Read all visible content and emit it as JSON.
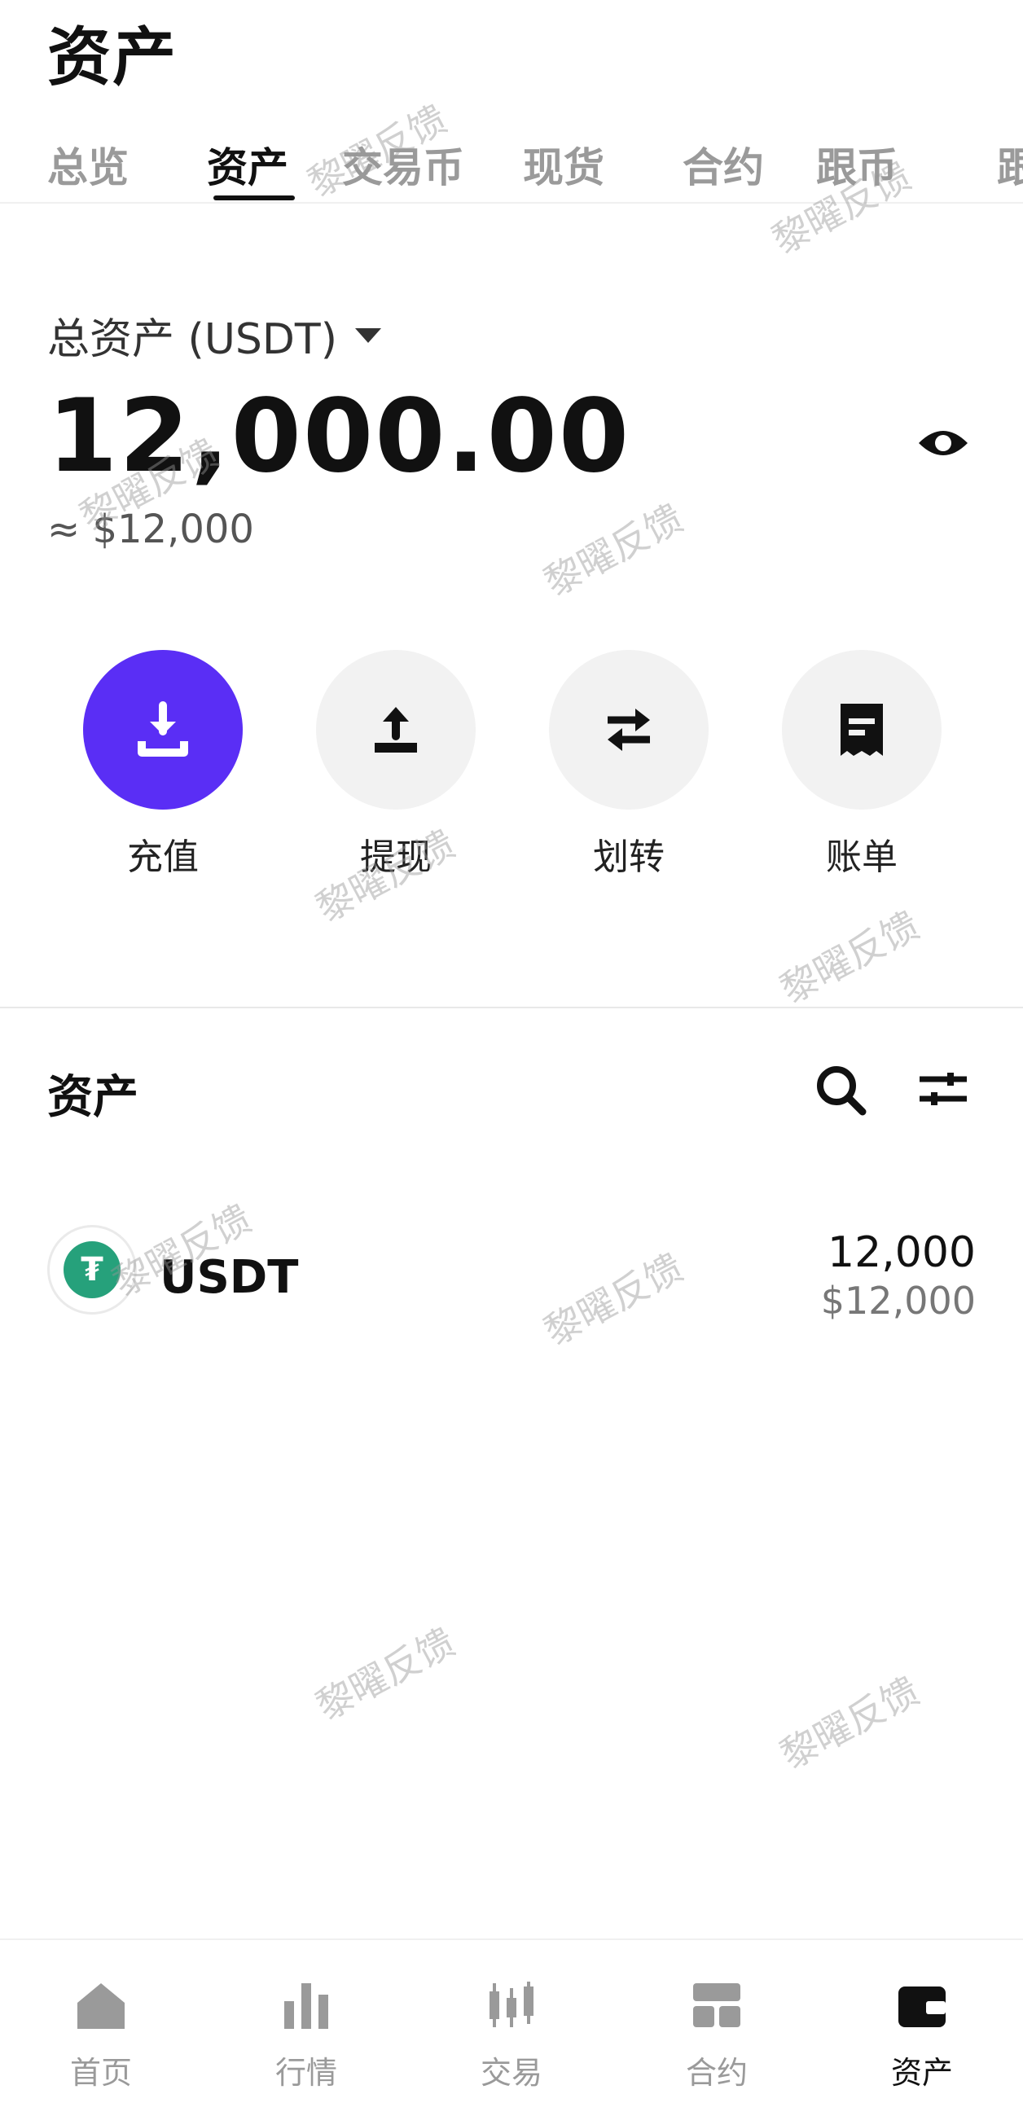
{
  "header": {
    "title": "资产"
  },
  "tabs": [
    {
      "label": "总览",
      "active": false
    },
    {
      "label": "资产",
      "active": true
    },
    {
      "label": "交易币",
      "active": false
    },
    {
      "label": "现货",
      "active": false
    },
    {
      "label": "合约",
      "active": false
    },
    {
      "label": "跟币",
      "active": false
    },
    {
      "label": "跟",
      "active": false
    }
  ],
  "summary": {
    "total_label": "总资产 (USDT)",
    "total_value": "12,000.00",
    "total_usd": "≈ $12,000",
    "eye_icon": "eye-icon"
  },
  "actions": [
    {
      "label": "充值",
      "icon": "deposit-icon"
    },
    {
      "label": "提现",
      "icon": "withdraw-icon"
    },
    {
      "label": "划转",
      "icon": "transfer-icon"
    },
    {
      "label": "账单",
      "icon": "bill-icon"
    }
  ],
  "assets_section": {
    "title": "资产",
    "search_icon": "search-icon",
    "filter_icon": "filter-icon",
    "items": [
      {
        "symbol": "USDT",
        "amount": "12,000",
        "usd_value": "$12,000",
        "icon_glyph": "₮"
      }
    ]
  },
  "bottom_nav": [
    {
      "label": "首页",
      "icon": "home-icon",
      "active": false
    },
    {
      "label": "行情",
      "icon": "market-icon",
      "active": false
    },
    {
      "label": "交易",
      "icon": "trade-icon",
      "active": false
    },
    {
      "label": "合约",
      "icon": "futures-icon",
      "active": false
    },
    {
      "label": "资产",
      "icon": "wallet-icon",
      "active": true
    }
  ],
  "watermark": "黎曜反馈",
  "colors": {
    "primary": "#5a2ef5",
    "usdt_green": "#26a17b",
    "text": "#111111",
    "muted": "#9a9a9a"
  }
}
